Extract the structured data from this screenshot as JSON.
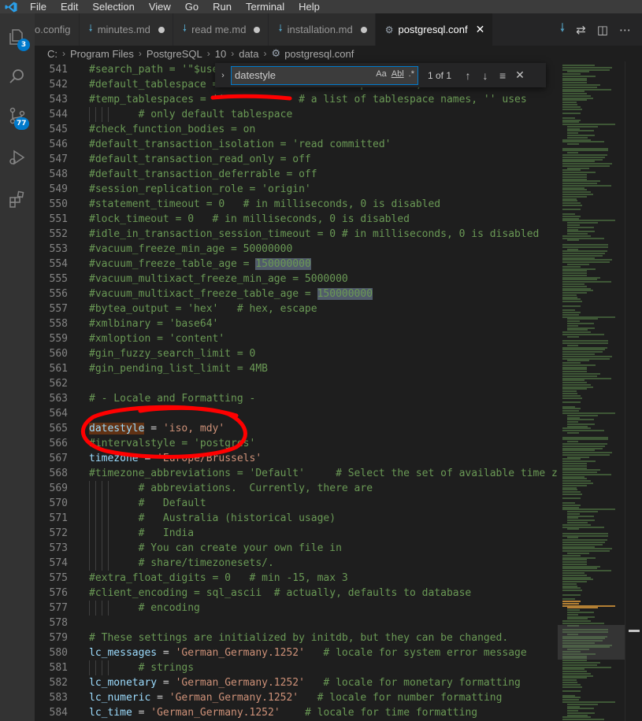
{
  "menu": [
    "File",
    "Edit",
    "Selection",
    "View",
    "Go",
    "Run",
    "Terminal",
    "Help"
  ],
  "activity": {
    "explorer_badge": "3",
    "scm_badge": "77"
  },
  "tabs": [
    {
      "label": "o.config",
      "icon": "config-file-icon",
      "modified": false,
      "active": false
    },
    {
      "label": "minutes.md",
      "icon": "markdown-icon",
      "modified": true,
      "active": false
    },
    {
      "label": "read me.md",
      "icon": "markdown-icon",
      "modified": true,
      "active": false
    },
    {
      "label": "installation.md",
      "icon": "markdown-icon",
      "modified": true,
      "active": false
    },
    {
      "label": "postgresql.conf",
      "icon": "gear-icon",
      "modified": false,
      "active": true
    }
  ],
  "breadcrumb": [
    "C:",
    "Program Files",
    "PostgreSQL",
    "10",
    "data",
    "postgresql.conf"
  ],
  "find": {
    "query": "datestyle",
    "match_case": "Aa",
    "whole_word": "Abl",
    "regex": ".*",
    "count": "1 of 1"
  },
  "lines": [
    {
      "n": "541",
      "text": "#search_path = '\"$user\", public'  # schema names"
    },
    {
      "n": "542",
      "text": "#default_tablespace = ''          # a tablespace name, '' uses the default"
    },
    {
      "n": "543",
      "text": "#temp_tablespaces = ''            # a list of tablespace names, '' uses"
    },
    {
      "n": "544",
      "text": "        # only default tablespace"
    },
    {
      "n": "545",
      "text": "#check_function_bodies = on"
    },
    {
      "n": "546",
      "text": "#default_transaction_isolation = 'read committed'"
    },
    {
      "n": "547",
      "text": "#default_transaction_read_only = off"
    },
    {
      "n": "548",
      "text": "#default_transaction_deferrable = off"
    },
    {
      "n": "549",
      "text": "#session_replication_role = 'origin'"
    },
    {
      "n": "550",
      "text": "#statement_timeout = 0   # in milliseconds, 0 is disabled"
    },
    {
      "n": "551",
      "text": "#lock_timeout = 0   # in milliseconds, 0 is disabled"
    },
    {
      "n": "552",
      "text": "#idle_in_transaction_session_timeout = 0 # in milliseconds, 0 is disabled"
    },
    {
      "n": "553",
      "text": "#vacuum_freeze_min_age = 50000000"
    },
    {
      "n": "554",
      "text": "#vacuum_freeze_table_age = 150000000"
    },
    {
      "n": "555",
      "text": "#vacuum_multixact_freeze_min_age = 5000000"
    },
    {
      "n": "556",
      "text": "#vacuum_multixact_freeze_table_age = 150000000"
    },
    {
      "n": "557",
      "text": "#bytea_output = 'hex'   # hex, escape"
    },
    {
      "n": "558",
      "text": "#xmlbinary = 'base64'"
    },
    {
      "n": "559",
      "text": "#xmloption = 'content'"
    },
    {
      "n": "560",
      "text": "#gin_fuzzy_search_limit = 0"
    },
    {
      "n": "561",
      "text": "#gin_pending_list_limit = 4MB"
    },
    {
      "n": "562",
      "text": ""
    },
    {
      "n": "563",
      "text": "# - Locale and Formatting -"
    },
    {
      "n": "564",
      "text": ""
    },
    {
      "n": "565",
      "key": "datestyle",
      "rest": " = ",
      "value": "'iso, mdy'"
    },
    {
      "n": "566",
      "text": "#intervalstyle = 'postgres'"
    },
    {
      "n": "567",
      "key": "timezone",
      "rest": " = ",
      "value": "'Europe/Brussels'"
    },
    {
      "n": "568",
      "text": "#timezone_abbreviations = 'Default'     # Select the set of available time zone"
    },
    {
      "n": "569",
      "text": "        # abbreviations.  Currently, there are"
    },
    {
      "n": "570",
      "text": "        #   Default"
    },
    {
      "n": "571",
      "text": "        #   Australia (historical usage)"
    },
    {
      "n": "572",
      "text": "        #   India"
    },
    {
      "n": "573",
      "text": "        # You can create your own file in"
    },
    {
      "n": "574",
      "text": "        # share/timezonesets/."
    },
    {
      "n": "575",
      "text": "#extra_float_digits = 0   # min -15, max 3"
    },
    {
      "n": "576",
      "text": "#client_encoding = sql_ascii  # actually, defaults to database"
    },
    {
      "n": "577",
      "text": "        # encoding"
    },
    {
      "n": "578",
      "text": ""
    },
    {
      "n": "579",
      "text": "# These settings are initialized by initdb, but they can be changed."
    },
    {
      "n": "580",
      "key": "lc_messages",
      "rest": " = ",
      "value": "'German_Germany.1252'",
      "comment": "   # locale for system error message"
    },
    {
      "n": "581",
      "text": "        # strings"
    },
    {
      "n": "582",
      "key": "lc_monetary",
      "rest": " = ",
      "value": "'German_Germany.1252'",
      "comment": "   # locale for monetary formatting"
    },
    {
      "n": "583",
      "key": "lc_numeric",
      "rest": " = ",
      "value": "'German_Germany.1252'",
      "comment": "   # locale for number formatting"
    },
    {
      "n": "584",
      "key": "lc_time",
      "rest": " = ",
      "value": "'German_Germany.1252'",
      "comment": "    # locale for time formatting"
    }
  ],
  "colors": {
    "editor_bg": "#1e1e1e",
    "comment": "#6a9955",
    "key": "#9cdcfe",
    "string": "#ce9178",
    "accent": "#007acc",
    "annotation": "#ff0000"
  }
}
